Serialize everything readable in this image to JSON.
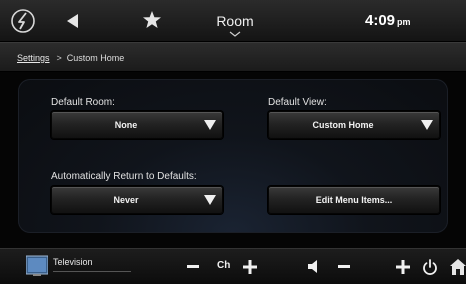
{
  "topbar": {
    "logo_icon": "swirl-logo-icon",
    "back_icon": "back-arrow-icon",
    "favorite_icon": "star-icon",
    "room_label": "Room",
    "time": "4:09",
    "ampm": "pm"
  },
  "breadcrumb": {
    "parent": "Settings",
    "separator": ">",
    "current": "Custom Home"
  },
  "settings": {
    "default_room": {
      "label": "Default Room:",
      "value": "None"
    },
    "default_view": {
      "label": "Default View:",
      "value": "Custom Home"
    },
    "auto_return": {
      "label": "Automatically Return to Defaults:",
      "value": "Never"
    },
    "edit_menu_label": "Edit Menu Items..."
  },
  "bottombar": {
    "source_label": "Television",
    "channel_label": "Ch",
    "icons": [
      "tv-thumbnail-icon",
      "minus-icon",
      "plus-icon",
      "speaker-icon",
      "minus-icon",
      "plus-icon",
      "power-icon",
      "home-icon"
    ]
  },
  "colors": {
    "panel_glow": "#1a2332",
    "text": "#ffffff",
    "accent_gray": "#cfcfcf"
  }
}
